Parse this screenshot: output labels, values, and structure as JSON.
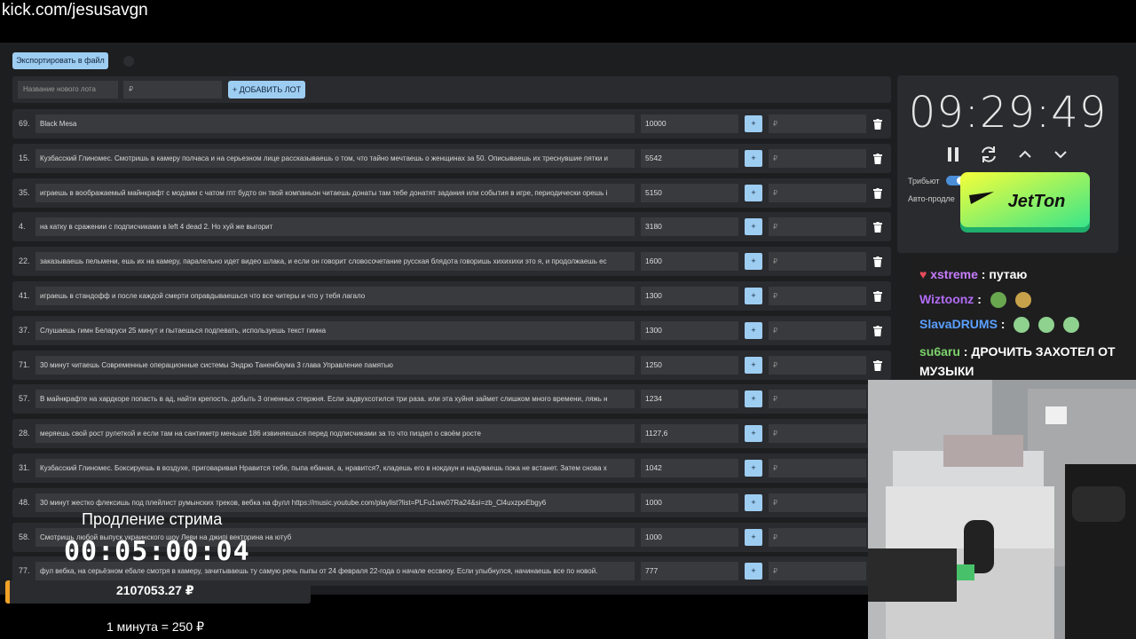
{
  "header": {
    "url": "kick.com/jesusavgn"
  },
  "toolbar": {
    "export_label": "Экспортировать в файл"
  },
  "add_lot": {
    "name_placeholder": "Название нового лота",
    "price_placeholder": "₽",
    "add_label": "+ ДОБАВИТЬ ЛОТ"
  },
  "lots": [
    {
      "num": "69.",
      "title": "Black Mesa",
      "amount": "10000"
    },
    {
      "num": "15.",
      "title": "Кузбасский Глиномес. Смотришь в камеру полчаса и на серьезном лице рассказываешь о том, что тайно мечтаешь о женщинах за 50. Описываешь их треснувшие пятки и",
      "amount": "5542"
    },
    {
      "num": "35.",
      "title": "играешь в воображаемый майнкрафт с модами с чатом гпт будто он твой компаньон читаешь донаты там тебе донатят задания или события в игре, периодически орешь i",
      "amount": "5150"
    },
    {
      "num": "4.",
      "title": "на катку в сражении с подписчиками в left 4 dead 2. Но хуй же выгорит",
      "amount": "3180"
    },
    {
      "num": "22.",
      "title": "заказываешь пельмени, ешь их на камеру, паралельно идет видео шлака, и если он говорит словосочетание русская блядота говоришь хихихихи это я, и продолжаешь ес",
      "amount": "1600"
    },
    {
      "num": "41.",
      "title": "играешь в стандофф и после каждой смерти оправдываешься что все читеры и что у тебя лагало",
      "amount": "1300"
    },
    {
      "num": "37.",
      "title": "Слушаешь гимн Беларуси 25 минут и пытаешься подпевать, используешь текст гимна",
      "amount": "1300"
    },
    {
      "num": "71.",
      "title": "30 минут читаешь Современные операционные системы Эндрю Таненбаума 3 глава Управление памятью",
      "amount": "1250"
    },
    {
      "num": "57.",
      "title": "В майнкрафте на хардкоре попасть в ад, найти крепость. добыть 3 огненных стержня. Если задвухсотился три раза. или эта хуйня займет слишком много времени, ляжь н",
      "amount": "1234"
    },
    {
      "num": "28.",
      "title": "меряешь свой рост рулеткой и если там на сантиметр меньше 186 извиняешься перед подписчиками за то что пиздел о своём росте",
      "amount": "1127,6"
    },
    {
      "num": "31.",
      "title": "Кузбасский Глиномес. Боксируешь в воздухе, приговаривая Нравится тебе, пыпа ебаная, а, нравится?, кладешь его в нокдаун и надуваешь пока не встанет. Затем снова х",
      "amount": "1042"
    },
    {
      "num": "48.",
      "title": "30 минут жестко флексишь под плейлист румынских треков, вебка на фулл https://music.youtube.com/playlist?list=PLFu1ww07Ra24&si=zb_Cl4uxzpoEbgy6",
      "amount": "1000"
    },
    {
      "num": "58.",
      "title": "Смотришь любой выпуск украинского шоу Леви на джипі векторина на ютуб",
      "amount": "1000"
    },
    {
      "num": "77.",
      "title": "фул вебка, на серьёзном ебале смотря в камеру, зачитываешь ту самую речь пыпы от 24 февраля 22-года о начале ессвеоу. Если улыбнулся, начинаешь все по новой.",
      "amount": "777"
    }
  ],
  "row_input_placeholder": "₽",
  "row_plus_label": "+",
  "timer": {
    "time": "09:29:49",
    "opt_tribute": "Трибьют",
    "opt_autoextend": "Авто-продле"
  },
  "sponsor": {
    "brand": "JETTON"
  },
  "chat": {
    "messages": [
      {
        "user": "xstreme",
        "text": "путаю"
      },
      {
        "user": "Wiztoonz",
        "text": ""
      },
      {
        "user": "SlavaDRUMS",
        "text": ""
      },
      {
        "user": "su6aru",
        "text": "ДРОЧИТЬ ЗАХОТЕЛ ОТ МУЗЫКИ"
      }
    ]
  },
  "extension": {
    "label": "Продление стрима",
    "time": "00:05:00:04",
    "total": "2107053.27 ₽",
    "rate": "1 минута = 250 ₽"
  },
  "colors": {
    "accent": "#9ecdf2",
    "panel": "#2a2b2e",
    "input": "#393a3d",
    "total_accent": "#f2a227"
  }
}
